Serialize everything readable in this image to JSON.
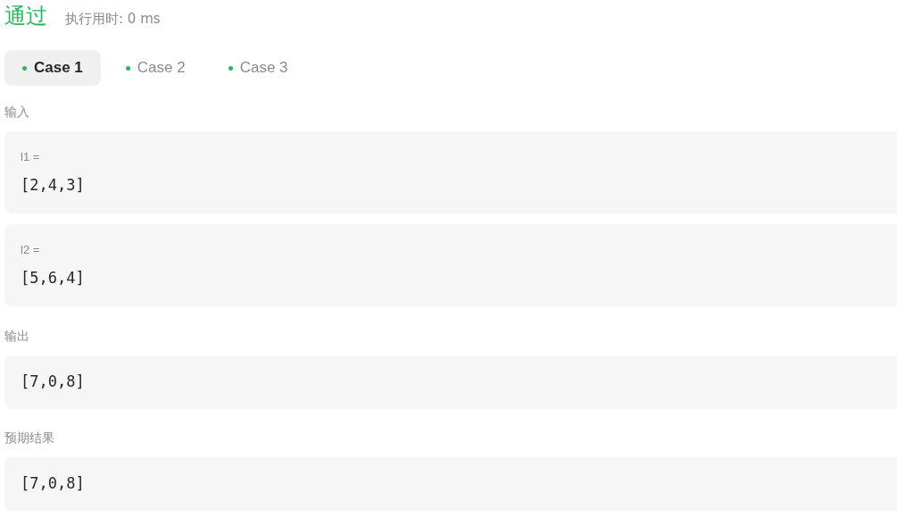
{
  "result": {
    "status": "通过",
    "runtime": "执行用时: 0 ms"
  },
  "cases": [
    {
      "label": "Case 1",
      "selected": true,
      "passed": true
    },
    {
      "label": "Case 2",
      "selected": false,
      "passed": true
    },
    {
      "label": "Case 3",
      "selected": false,
      "passed": true
    }
  ],
  "input": {
    "label": "输入",
    "params": [
      {
        "name": "l1 =",
        "value": "[2,4,3]"
      },
      {
        "name": "l2 =",
        "value": "[5,6,4]"
      }
    ]
  },
  "output": {
    "label": "输出",
    "value": "[7,0,8]"
  },
  "expected": {
    "label": "预期结果",
    "value": "[7,0,8]"
  }
}
